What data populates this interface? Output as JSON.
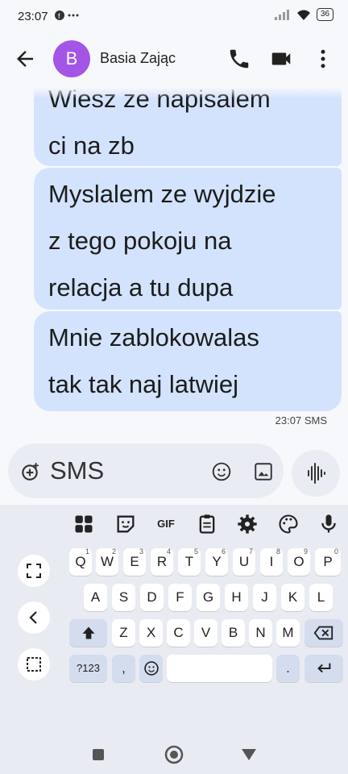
{
  "status_bar": {
    "time": "23:07",
    "battery": "36"
  },
  "app_bar": {
    "avatar_letter": "B",
    "contact_name": "Basia Zając"
  },
  "messages": [
    {
      "line1": "Wiesz ze napisalem",
      "line2": "ci na zb",
      "line3": ""
    },
    {
      "line1": "Myslalem ze wyjdzie",
      "line2": "z tego pokoju na",
      "line3": "relacja a tu dupa"
    },
    {
      "line1": "Mnie zablokowalas",
      "line2": "tak tak naj latwiej",
      "line3": ""
    }
  ],
  "message_meta": "23:07 SMS",
  "composer": {
    "placeholder": "SMS"
  },
  "keyboard": {
    "toolbar": {
      "gif": "GIF"
    },
    "row1": [
      {
        "k": "Q",
        "h": "1"
      },
      {
        "k": "W",
        "h": "2"
      },
      {
        "k": "E",
        "h": "3"
      },
      {
        "k": "R",
        "h": "4"
      },
      {
        "k": "T",
        "h": "5"
      },
      {
        "k": "Y",
        "h": "6"
      },
      {
        "k": "U",
        "h": "7"
      },
      {
        "k": "I",
        "h": "8"
      },
      {
        "k": "O",
        "h": "9"
      },
      {
        "k": "P",
        "h": "0"
      }
    ],
    "row2": [
      "A",
      "S",
      "D",
      "F",
      "G",
      "H",
      "J",
      "K",
      "L"
    ],
    "row3": [
      "Z",
      "X",
      "C",
      "V",
      "B",
      "N",
      "M"
    ],
    "symbols_key": "?123",
    "comma_key": ",",
    "period_key": "."
  },
  "colors": {
    "bubble": "#d3e3fd",
    "avatar": "#a355e6",
    "keyboard_bg": "#e8ebf2",
    "dark_key": "#d4ddee"
  }
}
